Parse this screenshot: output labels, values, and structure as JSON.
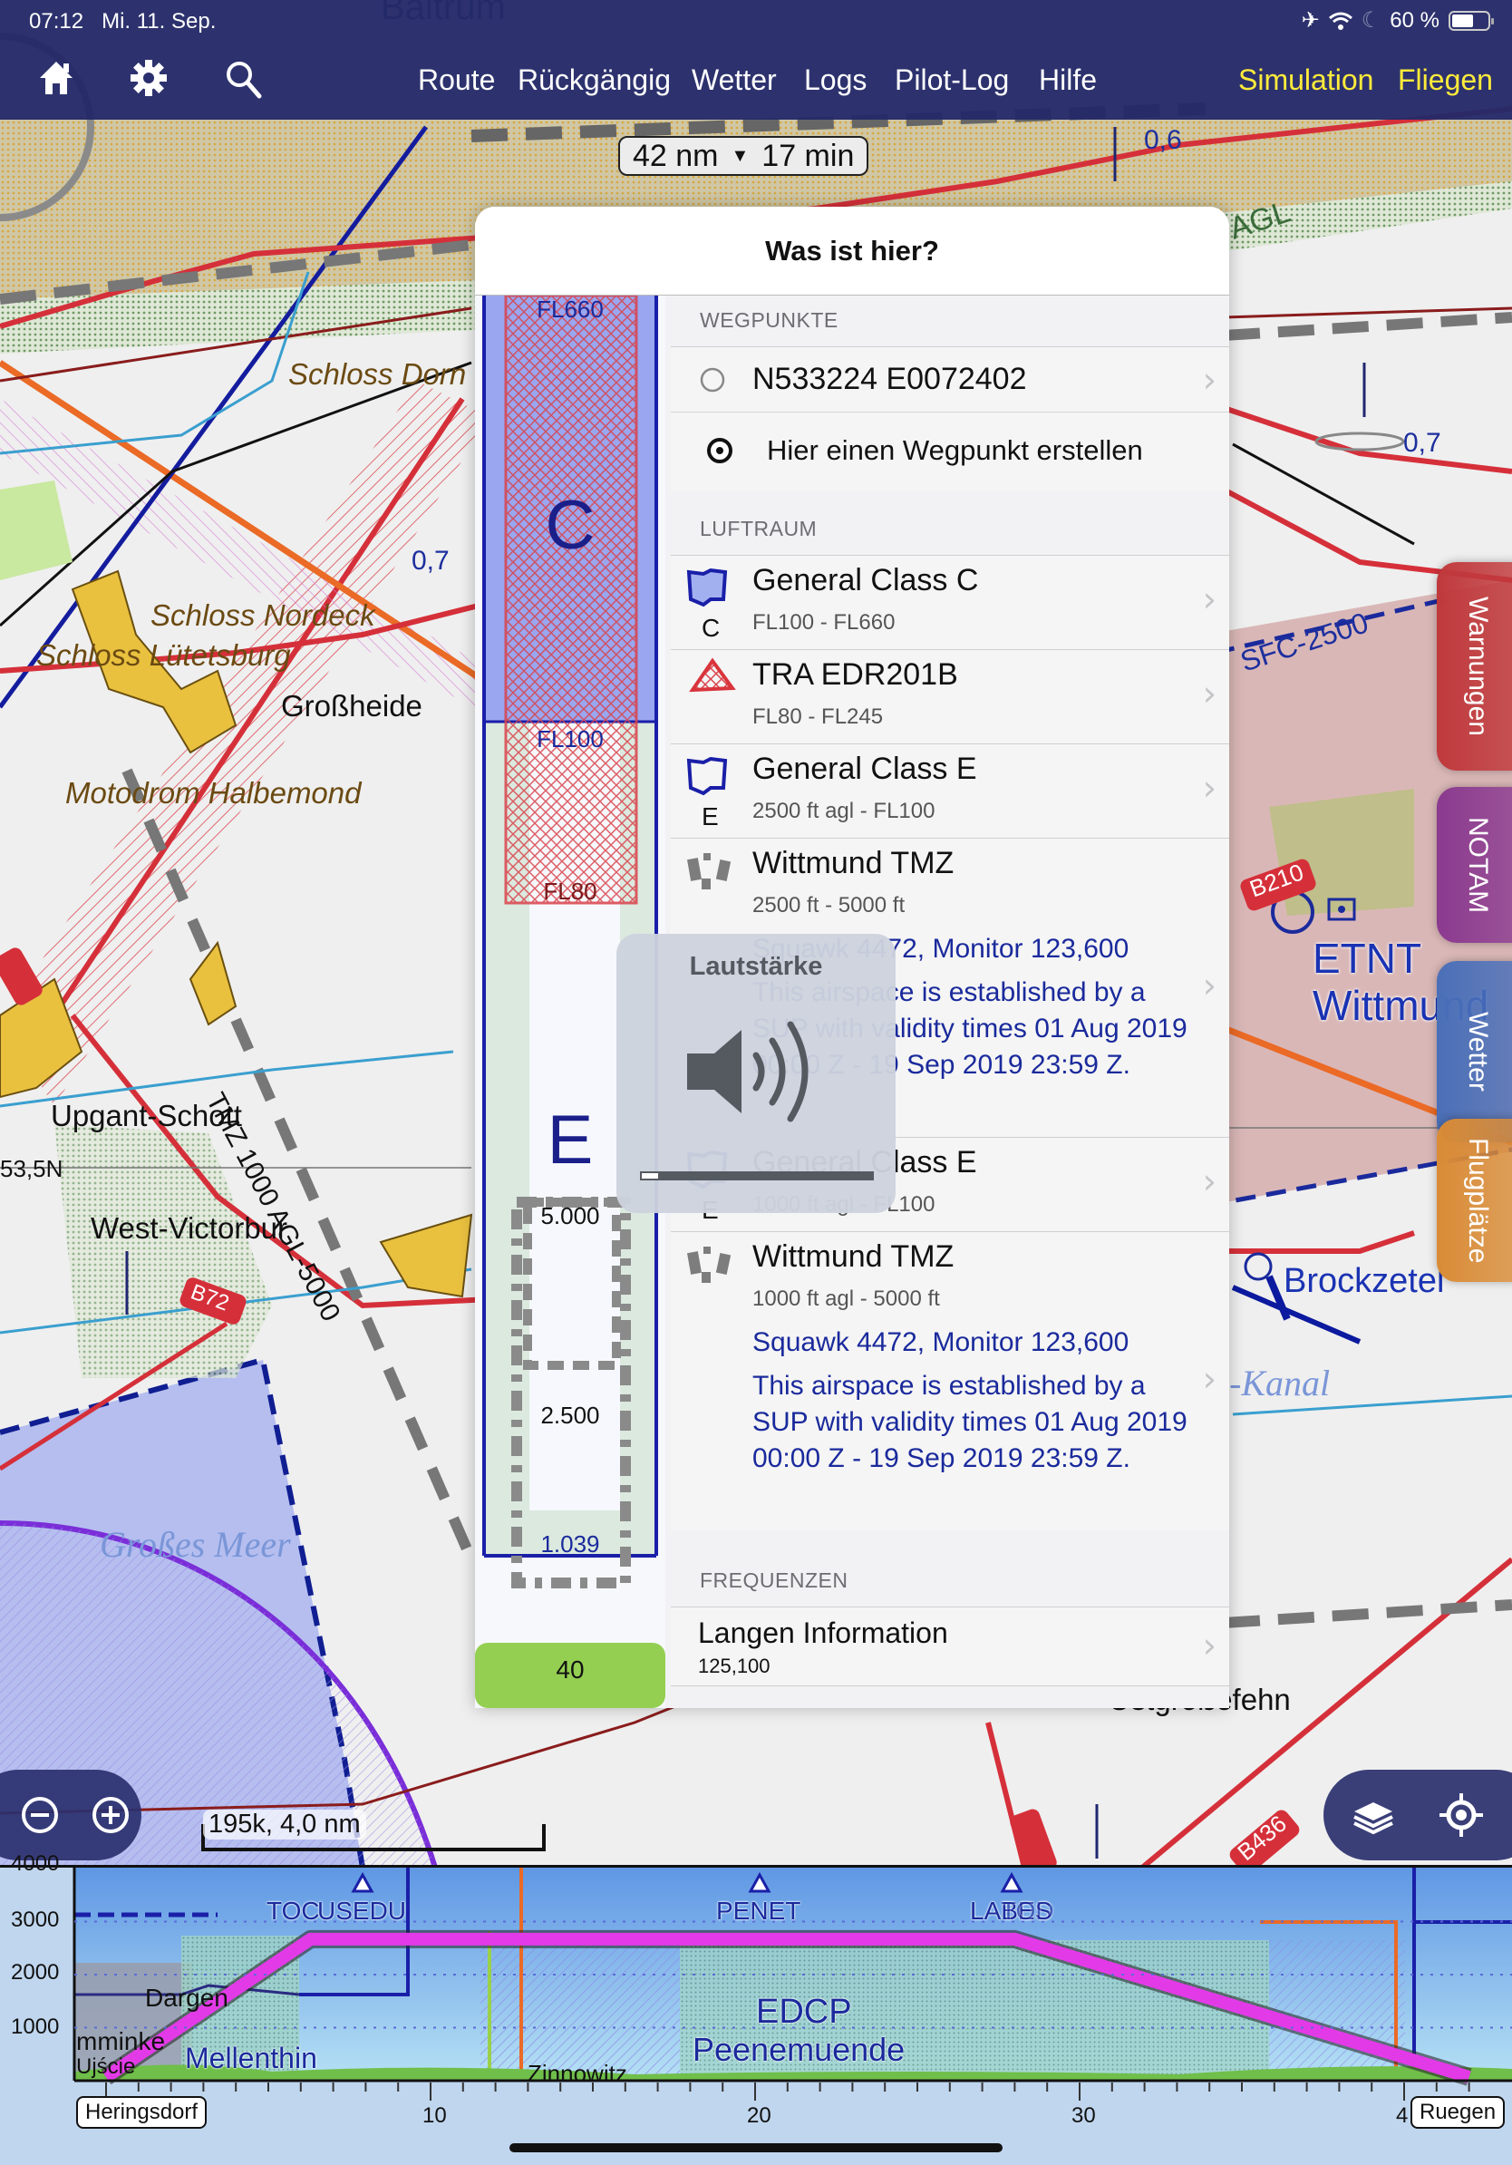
{
  "status_bar": {
    "time": "07:12",
    "date": "Mi. 11. Sep.",
    "battery_percent_label": "60 %",
    "battery_level": 0.6,
    "icons": [
      "airplane-mode-icon",
      "wifi-icon",
      "moon-icon",
      "battery-icon"
    ]
  },
  "toolbar": {
    "icons": [
      "home-icon",
      "gear-icon",
      "search-icon"
    ],
    "menu": [
      "Route",
      "Rückgängig",
      "Wetter",
      "Logs",
      "Pilot-Log",
      "Hilfe"
    ],
    "simulation_label": "Simulation",
    "fly_label": "Fliegen"
  },
  "route_summary": {
    "distance": "42 nm",
    "time": "17 min"
  },
  "panel": {
    "title": "Was ist hier?",
    "altitude_column": {
      "fl660": "FL660",
      "class_c": "C",
      "fl100": "FL100",
      "fl80": "FL80",
      "class_e": "E",
      "alt_5000": "5.000",
      "alt_2500": "2.500",
      "alt_1039": "1.039",
      "ground": "40"
    },
    "sections": {
      "waypoints": "WEGPUNKTE",
      "airspace": "LUFTRAUM",
      "frequencies": "FREQUENZEN"
    },
    "waypoints": [
      {
        "label": "N533224 E0072402",
        "icon": "circle-icon"
      },
      {
        "label": "Hier einen Wegpunkt erstellen",
        "icon": "target-icon"
      }
    ],
    "airspaces": [
      {
        "name": "General Class C",
        "class": "C",
        "range": "FL100 - FL660",
        "icon": "airspace-class-c-icon"
      },
      {
        "name": "TRA EDR201B",
        "class": "",
        "range": "FL80 - FL245",
        "icon": "restricted-area-icon"
      },
      {
        "name": "General Class E",
        "class": "E",
        "range": "2500 ft agl - FL100",
        "icon": "airspace-class-e-icon"
      },
      {
        "name": "Wittmund TMZ",
        "class": "",
        "range": "2500 ft - 5000 ft",
        "icon": "tmz-icon",
        "note1": "Squawk 4472, Monitor 123,600",
        "note2": "This airspace is established by a SUP with validity times 01 Aug 2019 00:00 Z - 19 Sep 2019 23:59 Z."
      },
      {
        "name": "General Class E",
        "class": "E",
        "range": "1000 ft agl - FL100",
        "icon": "airspace-class-e-icon"
      },
      {
        "name": "Wittmund TMZ",
        "class": "",
        "range": "1000 ft agl - 5000 ft",
        "icon": "tmz-icon",
        "note1": "Squawk 4472, Monitor 123,600",
        "note2": "This airspace is established by a SUP with validity times 01 Aug 2019 00:00 Z - 19 Sep 2019 23:59 Z."
      }
    ],
    "frequencies": [
      {
        "name": "Langen Information",
        "value": "125,100"
      }
    ]
  },
  "volume_hud": {
    "title": "Lautstärke",
    "level": 0.07
  },
  "side_tabs": [
    {
      "label": "Warnungen",
      "color": "#c0393c"
    },
    {
      "label": "NOTAM",
      "color": "#8b3a8f"
    },
    {
      "label": "Wetter",
      "color": "#4a6fb8"
    },
    {
      "label": "Flugplätze",
      "color": "#d98b36"
    }
  ],
  "map_controls": {
    "scale_label": "195k, 4,0 nm",
    "zoom_out_icon": "zoom-out-icon",
    "zoom_in_icon": "zoom-in-icon",
    "layers_icon": "layers-icon",
    "locate_icon": "locate-icon"
  },
  "map_labels": {
    "baltrum": "Baltrum",
    "schloss_dorn": "Schloss Dorn",
    "schloss_nordeck": "Schloss Nordeck",
    "schloss_luetetsburg": "Schloss Lütetsburg",
    "grossheide": "Großheide",
    "motodrom": "Motodrom Halbemond",
    "upgant_schott": "Upgant-Schott",
    "lat_label": "53,5N",
    "west_victorbur": "West-Victorbur",
    "tmz_label": "TMZ 1000 AGL-5000",
    "grosses_meer": "Großes Meer",
    "obstacle_1": "0,6",
    "obstacle_2": "0,7",
    "obstacle_3": "0,7",
    "agl_label": "AGL",
    "sfc_label": "SFC-2500",
    "b210": "B210",
    "b72": "B72",
    "b436": "B436",
    "etnt": "ETNT",
    "wittmund": "Wittmund",
    "brockzetel": "Brockzetel",
    "kanal": "-Kanal",
    "ostgrossefehn": "Ostgroßefehn"
  },
  "profile": {
    "y_ticks": [
      "4000",
      "3000",
      "2000",
      "1000"
    ],
    "x_ticks": [
      "10",
      "20",
      "30",
      "4"
    ],
    "start": "Heringsdorf",
    "end": "Ruegen",
    "waypoints": [
      "TOC",
      "USEDU",
      "PENET",
      "LABES",
      "TOD"
    ],
    "places": [
      "Dargen",
      "mminke",
      "Ujście",
      "Mellenthin",
      "Zinnowitz",
      "EDCP",
      "Peenemuende"
    ],
    "cruise_altitude_ft": 2600
  }
}
